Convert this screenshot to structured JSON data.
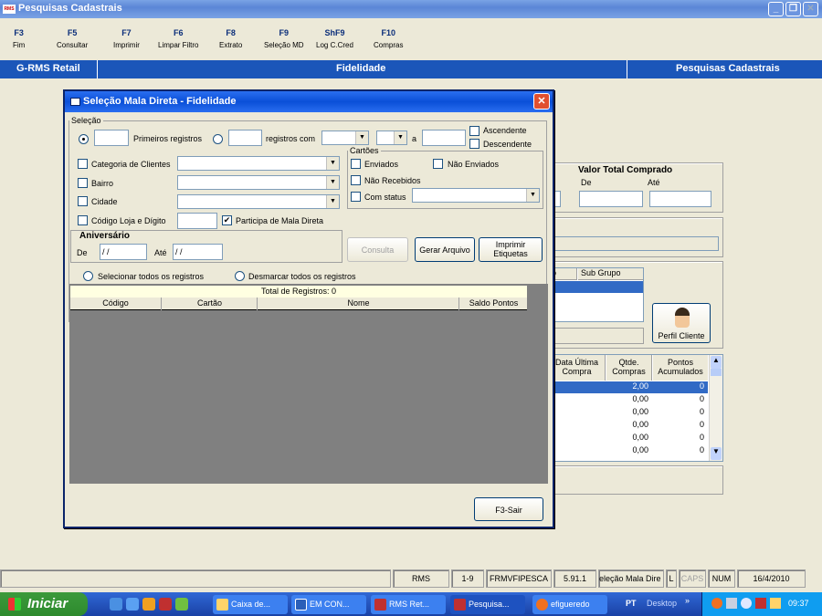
{
  "window": {
    "title": "Pesquisas Cadastrais",
    "app_badge": "RMS"
  },
  "toolbar": [
    {
      "key": "F3",
      "label": "Fim"
    },
    {
      "key": "F5",
      "label": "Consultar"
    },
    {
      "key": "F7",
      "label": "Imprimir"
    },
    {
      "key": "F6",
      "label": "Limpar Filtro"
    },
    {
      "key": "F8",
      "label": "Extrato"
    },
    {
      "key": "F9",
      "label": "Seleção MD"
    },
    {
      "key": "ShF9",
      "label": "Log C.Cred"
    },
    {
      "key": "F10",
      "label": "Compras"
    }
  ],
  "navbar": {
    "left": "G-RMS Retail",
    "center": "Fidelidade",
    "right": "Pesquisas Cadastrais"
  },
  "background": {
    "valor_total": {
      "title": "Valor Total Comprado",
      "de": "De",
      "ate": "Até"
    },
    "subgroup_headers": [
      "o",
      "Sub Grupo"
    ],
    "perfil_button": "Perfil Cliente",
    "table_headers": [
      "Data Última Compra",
      "Qtde. Compras",
      "Pontos Acumulados"
    ],
    "table_rows": [
      {
        "qtde": "2,00",
        "pontos": "0"
      },
      {
        "qtde": "0,00",
        "pontos": "0"
      },
      {
        "qtde": "0,00",
        "pontos": "0"
      },
      {
        "qtde": "0,00",
        "pontos": "0"
      },
      {
        "qtde": "0,00",
        "pontos": "0"
      },
      {
        "qtde": "0,00",
        "pontos": "0"
      }
    ]
  },
  "dialog": {
    "title": "Seleção Mala Direta - Fidelidade",
    "selecao": {
      "legend": "Seleção",
      "primeiros_label": "Primeiros registros",
      "registros_com_label": "registros com",
      "a_label": "a",
      "ascendente": "Ascendente",
      "descendente": "Descendente"
    },
    "filters": [
      {
        "label": "Categoria de Clientes",
        "value": ""
      },
      {
        "label": "Bairro",
        "value": ""
      },
      {
        "label": "Cidade",
        "value": ""
      }
    ],
    "codigo_loja": "Código Loja e Dígito",
    "participa": "Participa de Mala Direta",
    "cartoes": {
      "legend": "Cartões",
      "enviados": "Enviados",
      "nao_enviados": "Não Enviados",
      "nao_recebidos": "Não Recebidos",
      "com_status": "Com status"
    },
    "aniversario": {
      "title": "Aniversário",
      "de": "De",
      "de_value": " / /",
      "ate": "Até",
      "ate_value": " / /"
    },
    "buttons": {
      "consulta": "Consulta",
      "gerar": "Gerar Arquivo",
      "imprimir": "Imprimir Etiquetas",
      "sair": "F3-Sair"
    },
    "select_all": "Selecionar todos os registros",
    "deselect_all": "Desmarcar todos os registros",
    "grid": {
      "total": "Total de Registros: 0",
      "columns": [
        "Código",
        "Cartão",
        "Nome",
        "Saldo Pontos"
      ]
    }
  },
  "statusbar": [
    "RMS",
    "1-9",
    "FRMVFIPESCA",
    "5.91.1",
    "eleção Mala Dire",
    "L",
    "CAPS",
    "NUM",
    "16/4/2010"
  ],
  "taskbar": {
    "start": "Iniciar",
    "tasks": [
      "Caixa de...",
      "EM CON...",
      "RMS Ret...",
      "Pesquisa...",
      "efigueredo"
    ],
    "lang": "PT",
    "desktop": "Desktop",
    "clock": "09:37"
  },
  "colors": {
    "title_blue": "#0a4fd8",
    "nav_blue": "#1b56b9",
    "selection": "#316ac5",
    "grid_gray": "#808080"
  }
}
